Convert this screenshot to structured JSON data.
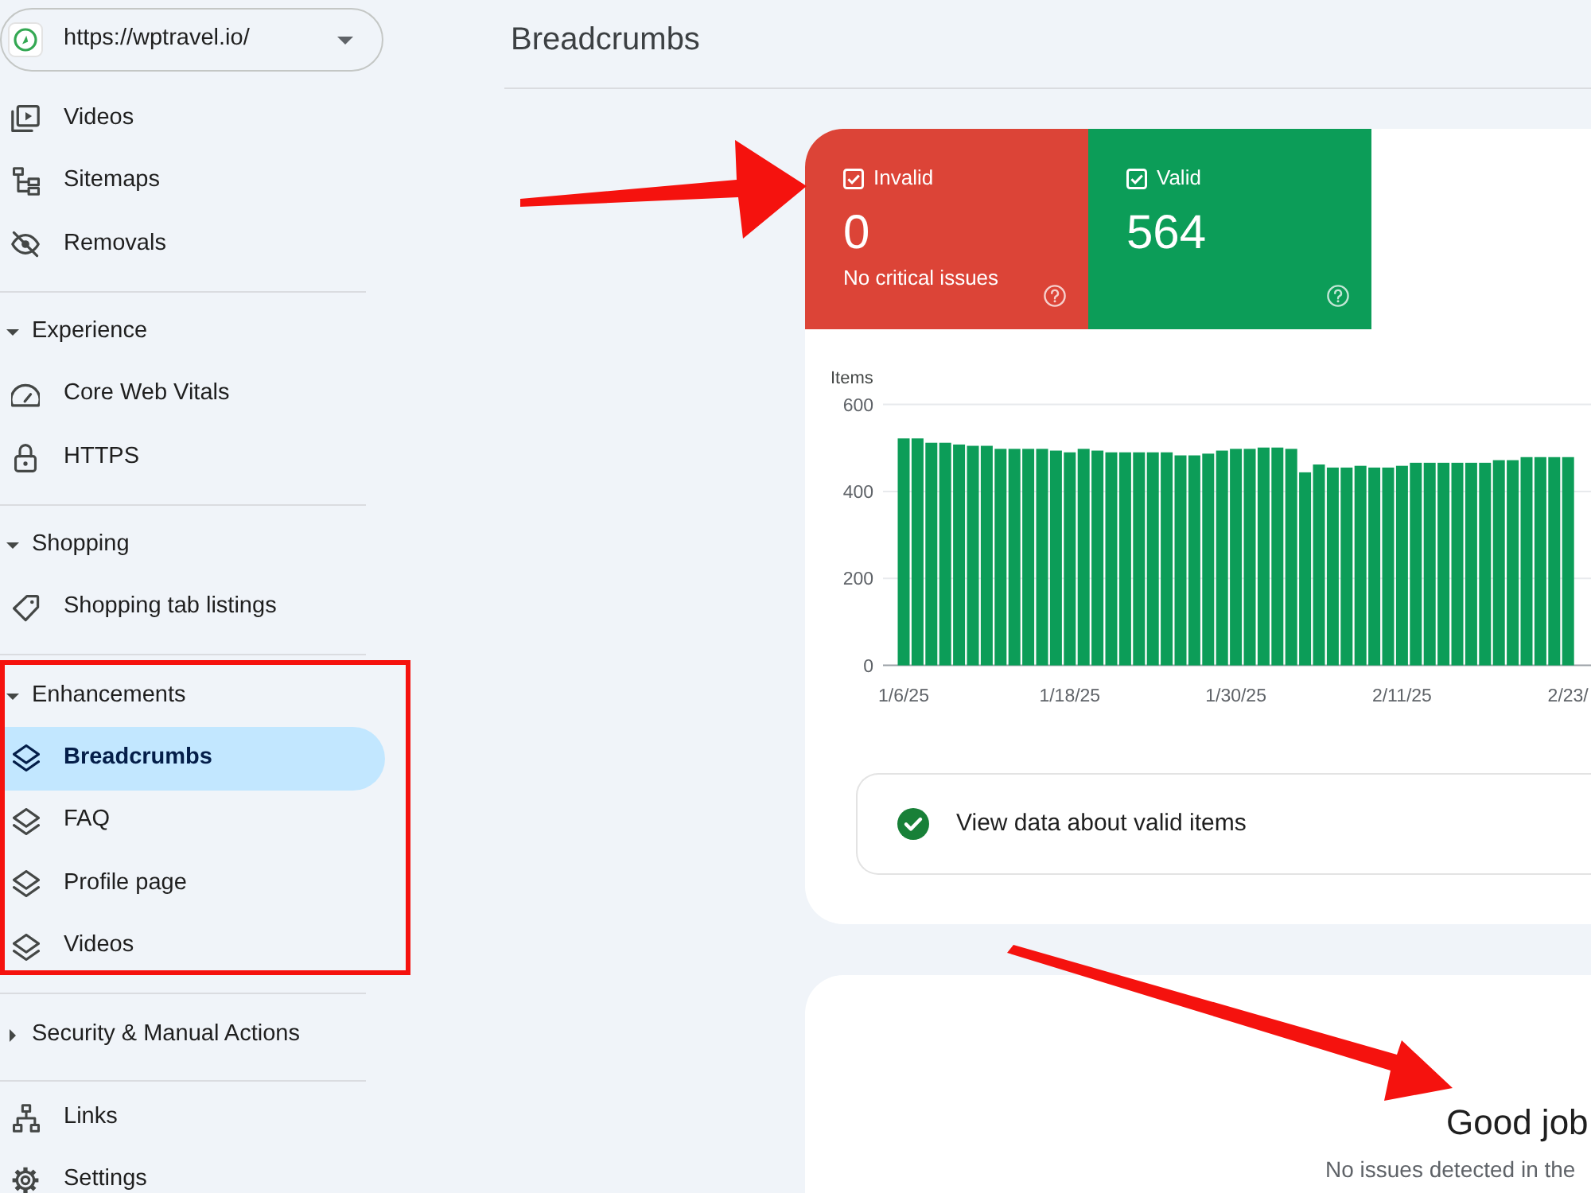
{
  "sidebar": {
    "property_selector": {
      "url": "https://wptravel.io/"
    },
    "sections": [
      {
        "highlighted": false,
        "items": [
          {
            "label": "Videos",
            "kind": "video",
            "selected": false
          },
          {
            "label": "Sitemaps",
            "kind": "sitemap",
            "selected": false
          },
          {
            "label": "Removals",
            "kind": "removal",
            "selected": false
          }
        ]
      },
      {
        "highlighted": false,
        "header": {
          "label": "Experience",
          "expanded": true
        },
        "items": [
          {
            "label": "Core Web Vitals",
            "kind": "gauge",
            "selected": false
          },
          {
            "label": "HTTPS",
            "kind": "lock",
            "selected": false
          }
        ]
      },
      {
        "highlighted": false,
        "header": {
          "label": "Shopping",
          "expanded": true
        },
        "items": [
          {
            "label": "Shopping tab listings",
            "kind": "tag",
            "selected": false
          }
        ]
      },
      {
        "highlighted": true,
        "header": {
          "label": "Enhancements",
          "expanded": true
        },
        "items": [
          {
            "label": "Breadcrumbs",
            "kind": "layers",
            "selected": true
          },
          {
            "label": "FAQ",
            "kind": "layers",
            "selected": false
          },
          {
            "label": "Profile page",
            "kind": "layers",
            "selected": false
          },
          {
            "label": "Videos",
            "kind": "layers",
            "selected": false
          }
        ]
      },
      {
        "highlighted": false,
        "header": {
          "label": "Security & Manual Actions",
          "expanded": false
        }
      },
      {
        "highlighted": false,
        "items": [
          {
            "label": "Links",
            "kind": "links",
            "selected": false
          },
          {
            "label": "Settings",
            "kind": "settings",
            "selected": false
          }
        ]
      }
    ]
  },
  "page": {
    "title": "Breadcrumbs"
  },
  "report": {
    "tiles": [
      {
        "label": "Invalid",
        "checked": true,
        "count": "0",
        "note": "No critical issues",
        "color": "#dc4437",
        "annotated": true
      },
      {
        "label": "Valid",
        "checked": true,
        "count": "564",
        "color": "#0c9d58",
        "annotated": false
      }
    ],
    "chart_data": {
      "type": "bar",
      "ylabel": "Items",
      "categories": [
        "1/6/25",
        null,
        null,
        null,
        null,
        null,
        null,
        null,
        null,
        null,
        null,
        null,
        "1/18/25",
        null,
        null,
        null,
        null,
        null,
        null,
        null,
        null,
        null,
        null,
        null,
        "1/30/25",
        null,
        null,
        null,
        null,
        null,
        null,
        null,
        null,
        null,
        null,
        null,
        "2/11/25",
        null,
        null,
        null,
        null,
        null,
        null,
        null,
        null,
        null,
        null,
        null,
        "2/23/"
      ],
      "series": [
        {
          "color": "#0c9d58",
          "values": [
            522,
            522,
            512,
            512,
            508,
            505,
            505,
            498,
            498,
            498,
            498,
            494,
            490,
            498,
            494,
            490,
            490,
            490,
            490,
            490,
            483,
            483,
            487,
            494,
            498,
            498,
            501,
            501,
            498,
            444,
            462,
            455,
            455,
            459,
            455,
            455,
            459,
            466,
            466,
            466,
            466,
            466,
            466,
            472,
            472,
            479,
            479,
            479,
            479
          ]
        }
      ],
      "ylim": [
        0,
        600
      ],
      "yticks": [
        0,
        200,
        400,
        600
      ]
    },
    "details_link": {
      "label": "View data about valid items"
    }
  },
  "message": {
    "title": "Good job",
    "text": "No issues detected in the",
    "annotated": true
  }
}
